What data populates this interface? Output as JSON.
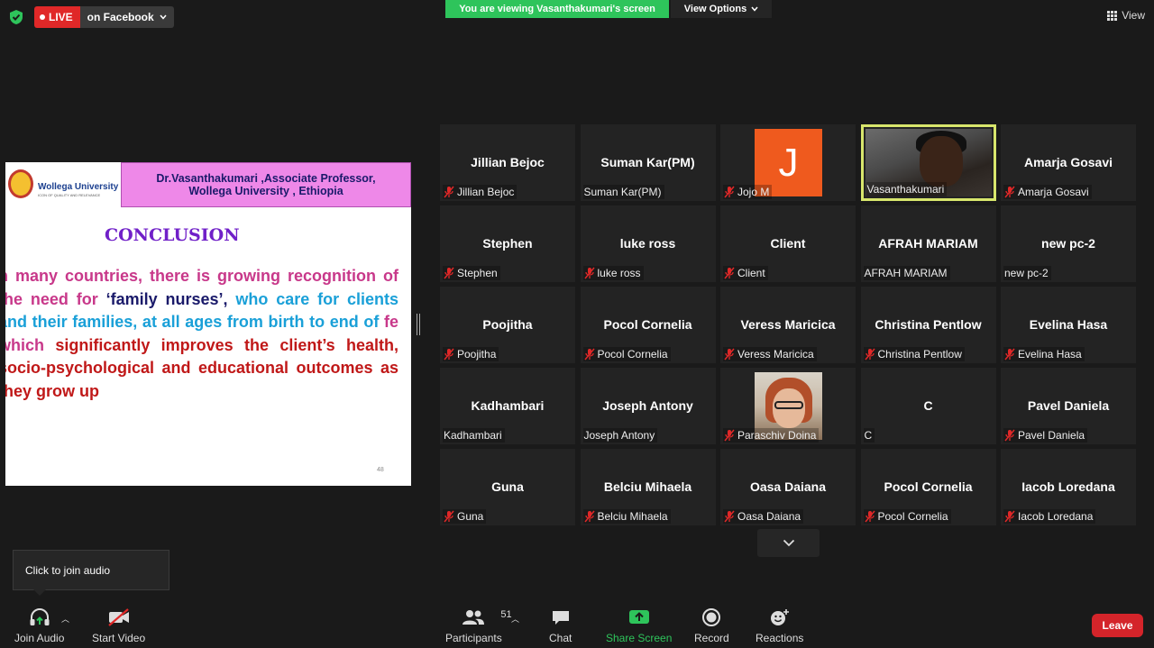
{
  "top": {
    "live_label": "LIVE",
    "live_destination": "on Facebook",
    "viewing_banner": "You are viewing Vasanthakumari's screen",
    "view_options_label": "View Options",
    "view_label": "View"
  },
  "slide": {
    "university_name": "Wollega University",
    "university_motto": "ICON OF QUALITY AND RELEVANCE",
    "header_line1": "Dr.Vasanthakumari ,Associate Professor,",
    "header_line2": "Wollega University , Ethiopia",
    "title": "CONCLUSION",
    "body_segments": [
      {
        "text": "n many countries, there is growing recognition of the need for ",
        "style": "pink"
      },
      {
        "text": "‘family nurses’,",
        "style": "blk"
      },
      {
        "text": " who care for clients and their families, at all ages from birth to end of ",
        "style": "blue"
      },
      {
        "text": "fe which ",
        "style": "pink"
      },
      {
        "text": "significantly improves the client’s health, socio-psychological and educational outcomes as they grow up",
        "style": "red"
      }
    ],
    "page_number": "48"
  },
  "participants": [
    {
      "display": "Jillian Bejoc",
      "label": "Jillian Bejoc",
      "muted": true,
      "kind": "name"
    },
    {
      "display": "Suman Kar(PM)",
      "label": "Suman Kar(PM)",
      "muted": false,
      "kind": "name"
    },
    {
      "display": "J",
      "label": "Jojo M",
      "muted": true,
      "kind": "letter"
    },
    {
      "display": "",
      "label": "Vasanthakumari",
      "muted": false,
      "kind": "video"
    },
    {
      "display": "Amarja Gosavi",
      "label": "Amarja Gosavi",
      "muted": true,
      "kind": "name"
    },
    {
      "display": "Stephen",
      "label": "Stephen",
      "muted": true,
      "kind": "name"
    },
    {
      "display": "luke ross",
      "label": "luke ross",
      "muted": true,
      "kind": "name"
    },
    {
      "display": "Client",
      "label": "Client",
      "muted": true,
      "kind": "name"
    },
    {
      "display": "AFRAH MARIAM",
      "label": "AFRAH MARIAM",
      "muted": false,
      "kind": "name"
    },
    {
      "display": "new pc-2",
      "label": "new pc-2",
      "muted": false,
      "kind": "name"
    },
    {
      "display": "Poojitha",
      "label": "Poojitha",
      "muted": true,
      "kind": "name"
    },
    {
      "display": "Pocol Cornelia",
      "label": "Pocol Cornelia",
      "muted": true,
      "kind": "name"
    },
    {
      "display": "Veress Maricica",
      "label": "Veress Maricica",
      "muted": true,
      "kind": "name"
    },
    {
      "display": "Christina Pentlow",
      "label": "Christina Pentlow",
      "muted": true,
      "kind": "name"
    },
    {
      "display": "Evelina Hasa",
      "label": "Evelina Hasa",
      "muted": true,
      "kind": "name"
    },
    {
      "display": "Kadhambari",
      "label": "Kadhambari",
      "muted": false,
      "kind": "name"
    },
    {
      "display": "Joseph Antony",
      "label": "Joseph Antony",
      "muted": false,
      "kind": "name"
    },
    {
      "display": "",
      "label": "Paraschiv Doina",
      "muted": true,
      "kind": "photo"
    },
    {
      "display": "C",
      "label": "C",
      "muted": false,
      "kind": "name"
    },
    {
      "display": "Pavel Daniela",
      "label": "Pavel Daniela",
      "muted": true,
      "kind": "name"
    },
    {
      "display": "Guna",
      "label": "Guna",
      "muted": true,
      "kind": "name"
    },
    {
      "display": "Belciu Mihaela",
      "label": "Belciu Mihaela",
      "muted": true,
      "kind": "name"
    },
    {
      "display": "Oasa Daiana",
      "label": "Oasa Daiana",
      "muted": true,
      "kind": "name"
    },
    {
      "display": "Pocol Cornelia",
      "label": "Pocol Cornelia",
      "muted": true,
      "kind": "name"
    },
    {
      "display": "Iacob Loredana",
      "label": "Iacob Loredana",
      "muted": true,
      "kind": "name"
    }
  ],
  "tooltip": {
    "text": "Click to join audio"
  },
  "toolbar": {
    "join_audio": "Join Audio",
    "start_video": "Start Video",
    "participants_count": "51",
    "participants": "Participants",
    "chat": "Chat",
    "share_screen": "Share Screen",
    "record": "Record",
    "reactions": "Reactions",
    "leave": "Leave"
  },
  "colors": {
    "share_green": "#2ec45b",
    "leave_red": "#d4242a",
    "active_speaker": "#d8e66c",
    "live_red": "#e02828"
  }
}
